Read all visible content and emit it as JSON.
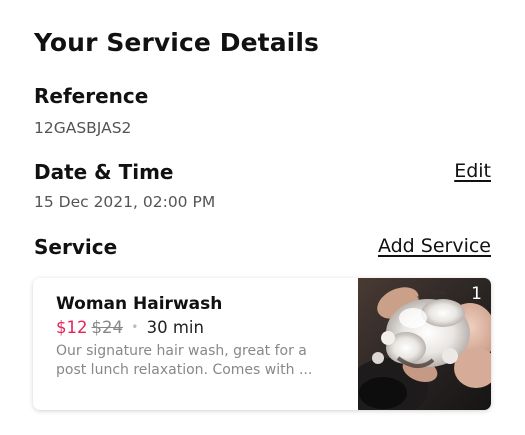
{
  "page": {
    "title": "Your Service Details"
  },
  "reference": {
    "label": "Reference",
    "value": "12GASBJAS2"
  },
  "datetime": {
    "label": "Date & Time",
    "value": "15 Dec 2021, 02:00 PM",
    "edit_label": "Edit"
  },
  "service": {
    "label": "Service",
    "add_label": "Add Service",
    "items": [
      {
        "name": "Woman Hairwash",
        "sale_price": "$12",
        "original_price": "$24",
        "separator": "•",
        "duration": "30 min",
        "description_line1": "Our signature hair wash, great for a",
        "description_line2": "post lunch relaxation. Comes with ...",
        "quantity": "1",
        "image_icon": "hairwash-photo"
      }
    ]
  },
  "colors": {
    "sale_price": "#e5245b",
    "muted_text": "#888888",
    "text": "#111111"
  }
}
